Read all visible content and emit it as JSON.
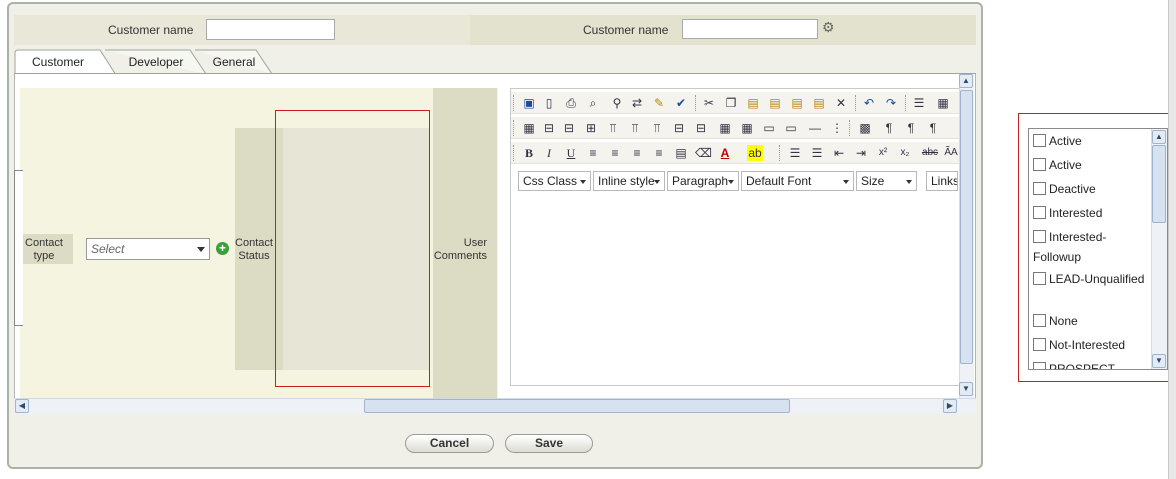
{
  "header": {
    "left_label": "Customer name",
    "right_label": "Customer name",
    "left_value": "",
    "right_value": ""
  },
  "tabs": [
    {
      "label": "Customer",
      "active": true
    },
    {
      "label": "Developer",
      "active": false
    },
    {
      "label": "General",
      "active": false
    }
  ],
  "form": {
    "contact_type_label": "Contact type",
    "contact_type_select": "Select",
    "contact_status_label": "Contact Status",
    "user_comments_label": "User Comments"
  },
  "editor": {
    "dropdowns": [
      {
        "value": "Css Class"
      },
      {
        "value": "Inline style"
      },
      {
        "value": "Paragraph"
      },
      {
        "value": "Default Font"
      },
      {
        "value": "Size"
      },
      {
        "value": "Links"
      }
    ],
    "toolbar_icons_row1": [
      "save-icon",
      "new-doc-icon",
      "print-icon",
      "preview-icon",
      "find-icon",
      "replace-icon",
      "paint-icon",
      "spellcheck-icon",
      "cut-icon",
      "copy-icon",
      "paste-icon",
      "paste-text-icon",
      "paste-word-icon",
      "paste-html-icon",
      "remove-icon",
      "undo-icon",
      "redo-icon",
      "indent-icon",
      "calendar-icon"
    ],
    "toolbar_icons_row2": [
      "table-icon",
      "insert-row-before-icon",
      "insert-row-after-icon",
      "insert-col-icon",
      "split-cell-icon",
      "merge-icon",
      "merge-down-icon",
      "delete-row-icon",
      "delete-col-icon",
      "grid-icon",
      "grid2-icon",
      "cell-props-icon",
      "hr-icon",
      "pagebreak-icon",
      "paragraph-icon",
      "ltr-icon",
      "rtl-icon"
    ],
    "toolbar_row3_labels": {
      "bold": "B",
      "italic": "I",
      "underline": "U",
      "superscript": "x²",
      "subscript": "x₂",
      "strike": "abc"
    }
  },
  "buttons": {
    "cancel": "Cancel",
    "save": "Save"
  },
  "status_list": {
    "items": [
      "Active",
      "Active",
      "Deactive",
      "Interested",
      "Interested-Followup",
      "LEAD-Unqualified",
      "None",
      "Not-Interested",
      "PROSPECT"
    ]
  },
  "colors": {
    "accent_red": "#c81e1e",
    "panel_bg": "#f5f4e1",
    "label_bg": "#dcdbc4"
  }
}
